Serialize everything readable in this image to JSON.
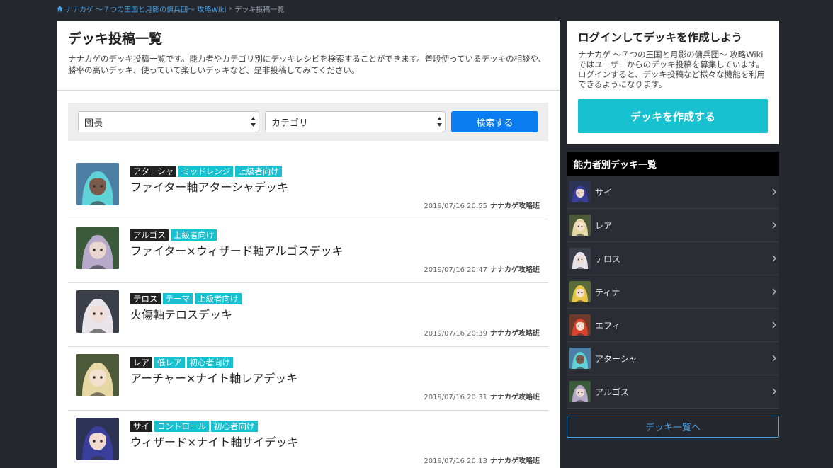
{
  "breadcrumb": {
    "home": "ナナカゲ 〜７つの王国と月影の傭兵団〜 攻略Wiki",
    "separator": "›",
    "current": "デッキ投稿一覧"
  },
  "main": {
    "title": "デッキ投稿一覧",
    "description": "ナナカゲのデッキ投稿一覧です。能力者やカテゴリ別にデッキレシピを検索することができます。普段使っているデッキの相談や、勝率の高いデッキ、使っていて楽しいデッキなど、是非投稿してみてください。"
  },
  "search": {
    "select1": "団長",
    "select2": "カテゴリ",
    "button": "検索する"
  },
  "decks": [
    {
      "tags": [
        {
          "label": "アターシャ",
          "style": "dark"
        },
        {
          "label": "ミッドレンジ",
          "style": "teal"
        },
        {
          "label": "上級者向け",
          "style": "teal"
        }
      ],
      "title": "ファイター軸アターシャデッキ",
      "date": "2019/07/16 20:55",
      "author": "ナナカゲ攻略班",
      "avatar": {
        "hair": "#5fd3d8",
        "skin": "#7a5a4a",
        "bg": "#4d7fa6"
      }
    },
    {
      "tags": [
        {
          "label": "アルゴス",
          "style": "dark"
        },
        {
          "label": "上級者向け",
          "style": "teal"
        }
      ],
      "title": "ファイター×ウィザード軸アルゴスデッキ",
      "date": "2019/07/16 20:47",
      "author": "ナナカゲ攻略班",
      "avatar": {
        "hair": "#b7a9c9",
        "skin": "#e9d6d0",
        "bg": "#3c5b3a"
      }
    },
    {
      "tags": [
        {
          "label": "テロス",
          "style": "dark"
        },
        {
          "label": "テーマ",
          "style": "teal"
        },
        {
          "label": "上級者向け",
          "style": "teal"
        }
      ],
      "title": "火傷軸テロスデッキ",
      "date": "2019/07/16 20:39",
      "author": "ナナカゲ攻略班",
      "avatar": {
        "hair": "#e8e4ea",
        "skin": "#f1ddd7",
        "bg": "#3b3f4a"
      }
    },
    {
      "tags": [
        {
          "label": "レア",
          "style": "dark"
        },
        {
          "label": "低レア",
          "style": "teal"
        },
        {
          "label": "初心者向け",
          "style": "teal"
        }
      ],
      "title": "アーチャー×ナイト軸レアデッキ",
      "date": "2019/07/16 20:31",
      "author": "ナナカゲ攻略班",
      "avatar": {
        "hair": "#e6d7a3",
        "skin": "#f4e0cf",
        "bg": "#4d5a3a"
      }
    },
    {
      "tags": [
        {
          "label": "サイ",
          "style": "dark"
        },
        {
          "label": "コントロール",
          "style": "teal"
        },
        {
          "label": "初心者向け",
          "style": "teal"
        }
      ],
      "title": "ウィザード×ナイト軸サイデッキ",
      "date": "2019/07/16 20:13",
      "author": "ナナカゲ攻略班",
      "avatar": {
        "hair": "#3a3f9c",
        "skin": "#f0d9cf",
        "bg": "#2c3355"
      }
    }
  ],
  "login": {
    "title": "ログインしてデッキを作成しよう",
    "description": "ナナカゲ 〜７つの王国と月影の傭兵団〜 攻略Wikiではユーザーからのデッキ投稿を募集しています。ログインすると、デッキ投稿など様々な機能を利用できるようになります。",
    "button": "デッキを作成する"
  },
  "sidebar": {
    "heading": "能力者別デッキ一覧",
    "items": [
      {
        "name": "サイ",
        "avatar": {
          "hair": "#3a3f9c",
          "skin": "#f0d9cf",
          "bg": "#2c3355"
        }
      },
      {
        "name": "レア",
        "avatar": {
          "hair": "#e6d7a3",
          "skin": "#f4e0cf",
          "bg": "#4d5a3a"
        }
      },
      {
        "name": "テロス",
        "avatar": {
          "hair": "#e8e4ea",
          "skin": "#f1ddd7",
          "bg": "#3b3f4a"
        }
      },
      {
        "name": "ティナ",
        "avatar": {
          "hair": "#e9c64a",
          "skin": "#f4e0cf",
          "bg": "#5a6b3a"
        }
      },
      {
        "name": "エフィ",
        "avatar": {
          "hair": "#d9432e",
          "skin": "#f4e0cf",
          "bg": "#6b3a2a"
        }
      },
      {
        "name": "アターシャ",
        "avatar": {
          "hair": "#5fd3d8",
          "skin": "#7a5a4a",
          "bg": "#4d7fa6"
        }
      },
      {
        "name": "アルゴス",
        "avatar": {
          "hair": "#b7a9c9",
          "skin": "#e9d6d0",
          "bg": "#3c5b3a"
        }
      }
    ],
    "all_button": "デッキ一覧へ"
  },
  "colors": {
    "accent": "#17c1cf",
    "primary": "#0a7cf0",
    "link": "#4aa3e6"
  },
  "icons": {
    "home": "home-icon",
    "chevron": "chevron-right-icon",
    "select_arrows": "select-arrows-icon"
  }
}
